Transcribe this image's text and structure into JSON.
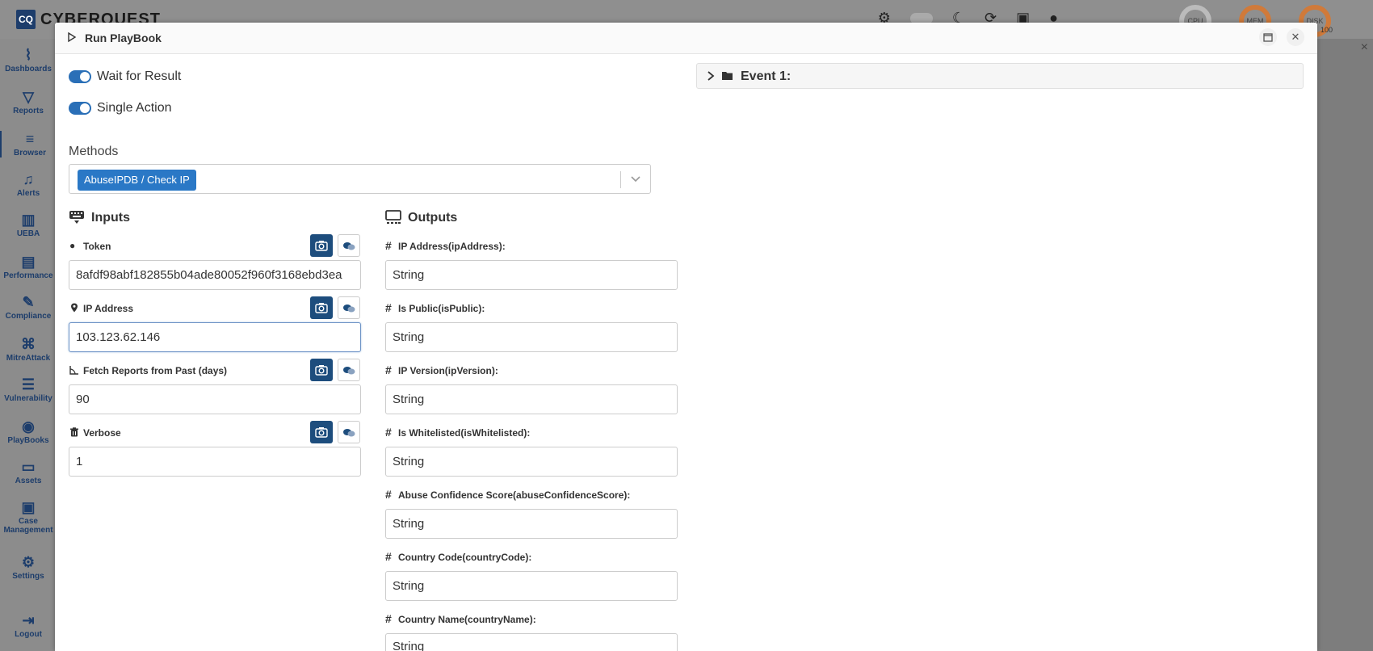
{
  "app": {
    "logo": "CQ",
    "name": "CYBERQUEST",
    "gauges": {
      "cpu": "CPU",
      "mem": "MEM",
      "disk": "DISK",
      "disk_value": "100"
    }
  },
  "sidebar": {
    "items": [
      {
        "label": "Dashboards",
        "icon": "chart-area-icon"
      },
      {
        "label": "Reports",
        "icon": "filter-icon"
      },
      {
        "label": "Browser",
        "icon": "list-icon"
      },
      {
        "label": "Alerts",
        "icon": "bell-icon"
      },
      {
        "label": "UEBA",
        "icon": "bar-chart-icon"
      },
      {
        "label": "Performance",
        "icon": "memory-icon"
      },
      {
        "label": "Compliance",
        "icon": "compliance-icon"
      },
      {
        "label": "MitreAttack",
        "icon": "command-icon"
      },
      {
        "label": "Vulnerability",
        "icon": "server-icon"
      },
      {
        "label": "PlayBooks",
        "icon": "pause-circle-icon"
      },
      {
        "label": "Assets",
        "icon": "laptop-icon"
      },
      {
        "label": "Case Management",
        "icon": "briefcase-icon"
      },
      {
        "label": "Settings",
        "icon": "gear-icon"
      },
      {
        "label": "Logout",
        "icon": "logout-icon"
      }
    ]
  },
  "modal": {
    "title": "Run PlayBook",
    "toggles": [
      {
        "label": "Wait for Result",
        "on": true
      },
      {
        "label": "Single Action",
        "on": true
      }
    ],
    "methods": {
      "label": "Methods",
      "selected": "AbuseIPDB / Check IP"
    },
    "inputs": {
      "title": "Inputs",
      "fields": [
        {
          "label": "Token",
          "icon": "user-secret-icon",
          "value": "8afdf98abf182855b04ade80052f960f3168ebd3ea"
        },
        {
          "label": "IP Address",
          "icon": "map-marker-icon",
          "value": "103.123.62.146"
        },
        {
          "label": "Fetch Reports from Past (days)",
          "icon": "angle-icon",
          "value": "90"
        },
        {
          "label": "Verbose",
          "icon": "trash-icon",
          "value": "1"
        }
      ]
    },
    "outputs": {
      "title": "Outputs",
      "fields": [
        {
          "label": "IP Address(ipAddress):",
          "value": "String"
        },
        {
          "label": "Is Public(isPublic):",
          "value": "String"
        },
        {
          "label": "IP Version(ipVersion):",
          "value": "String"
        },
        {
          "label": "Is Whitelisted(isWhitelisted):",
          "value": "String"
        },
        {
          "label": "Abuse Confidence Score(abuseConfidenceScore):",
          "value": "String"
        },
        {
          "label": "Country Code(countryCode):",
          "value": "String"
        },
        {
          "label": "Country Name(countryName):",
          "value": "String"
        }
      ]
    },
    "event": {
      "label": "Event 1:"
    }
  }
}
